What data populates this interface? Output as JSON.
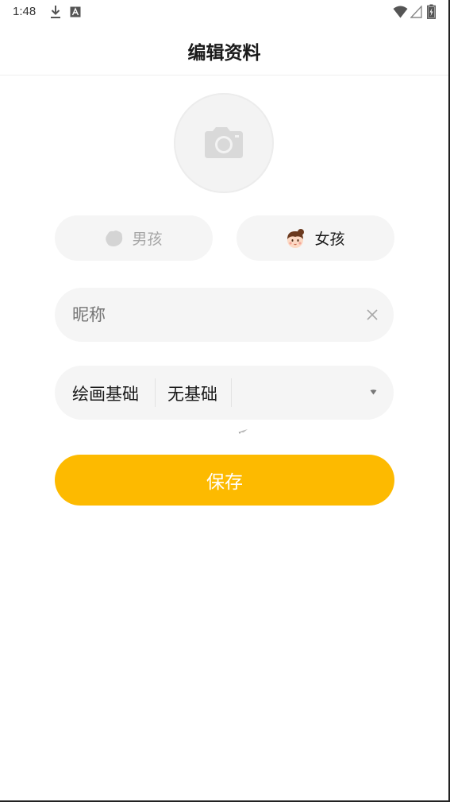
{
  "status_bar": {
    "time": "1:48",
    "icons": [
      "download-icon",
      "a-badge-icon",
      "wifi-icon",
      "signal-icon",
      "battery-charging-icon"
    ]
  },
  "header": {
    "title": "编辑资料"
  },
  "avatar": {
    "icon": "camera-icon"
  },
  "gender": {
    "boy_label": "男孩",
    "girl_label": "女孩",
    "selected": "女孩"
  },
  "nickname": {
    "placeholder": "昵称",
    "value": ""
  },
  "drawing_base": {
    "label": "绘画基础",
    "value": "无基础"
  },
  "save": {
    "label": "保存"
  },
  "colors": {
    "accent": "#fdba00",
    "field_bg": "#f5f5f5",
    "muted_text": "#a6a6a6"
  }
}
